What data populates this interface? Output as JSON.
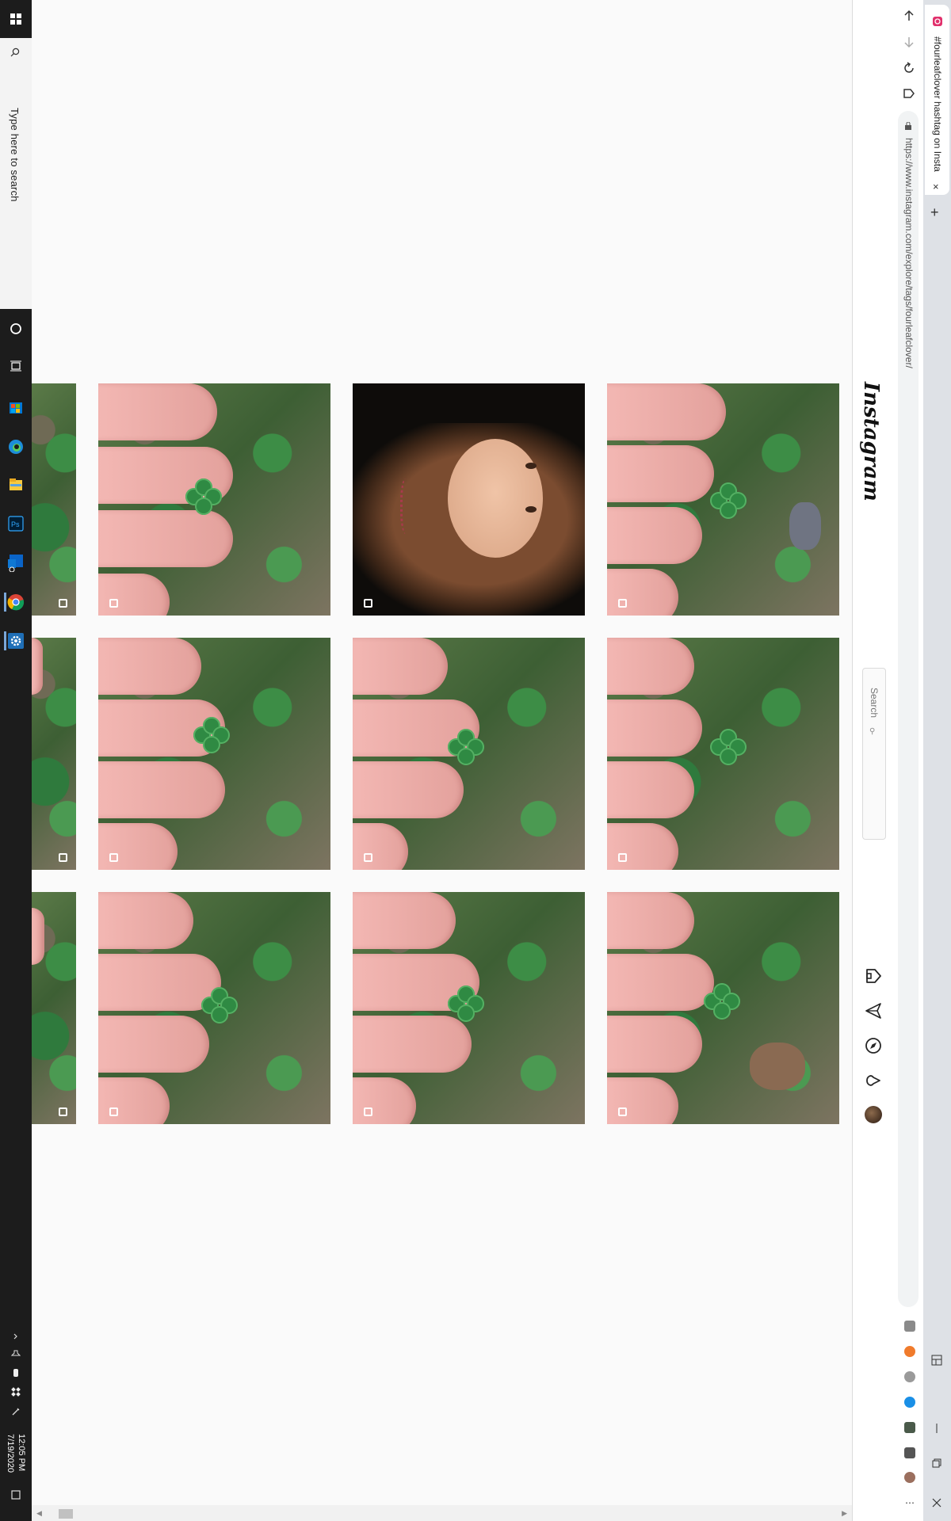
{
  "taskbar": {
    "search_placeholder": "Type here to search",
    "time": "12:05 PM",
    "date": "7/19/2020",
    "icons": [
      "windows-start-icon",
      "search-icon",
      "cortana-icon",
      "task-view-icon",
      "store-icon",
      "edge-icon",
      "file-explorer-icon",
      "photoshop-icon",
      "outlook-icon",
      "chrome-icon",
      "settings-icon"
    ],
    "tray": [
      "show-hidden-icon",
      "volume-icon",
      "battery-icon",
      "dropbox-icon",
      "pen-icon",
      "notification-icon"
    ]
  },
  "browser": {
    "tab_title": "#fourleafclover hashtag on Insta",
    "url": "https://www.instagram.com/explore/tags/fourleafclover/",
    "new_tab": "+",
    "tab_close": "×"
  },
  "instagram": {
    "logo": "Instagram",
    "search_placeholder": "Search",
    "nav_icons": [
      "home-icon",
      "direct-icon",
      "explore-icon",
      "activity-icon",
      "profile-avatar"
    ]
  },
  "grid": {
    "rows": 3,
    "posts": [
      {
        "id": "post-r1-c1",
        "type": "hand-clover"
      },
      {
        "id": "post-r1-c2",
        "type": "portrait"
      },
      {
        "id": "post-r1-c3",
        "type": "hand-clover"
      },
      {
        "id": "post-r2-c1",
        "type": "hand-clover"
      },
      {
        "id": "post-r2-c2",
        "type": "hand-clover"
      },
      {
        "id": "post-r2-c3",
        "type": "hand-clover"
      },
      {
        "id": "post-r3-c1",
        "type": "hand-clover"
      },
      {
        "id": "post-r3-c2",
        "type": "hand-clover"
      },
      {
        "id": "post-r3-c3",
        "type": "hand-clover"
      }
    ]
  },
  "colors": {
    "taskbar_bg": "#1c1c1c",
    "page_bg": "#fafafa",
    "tab_strip": "#dee1e6",
    "clover_green": "#2f8a43",
    "skin": "#e3a19c"
  }
}
